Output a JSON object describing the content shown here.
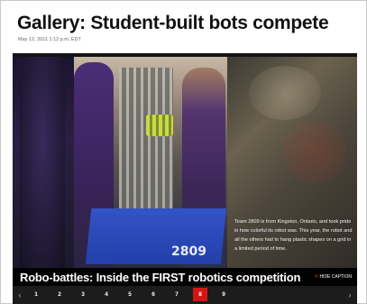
{
  "article": {
    "title": "Gallery: Student-built bots compete",
    "dateline": "May 12, 2011 1:12 p.m. EDT"
  },
  "slide": {
    "robot_number": "2809",
    "caption": "Team 2809 is from Kingston, Ontario, and took pride in how colorful its robot was. This year, the robot and all the others had to hang plastic shapes on a grid in a limited period of time.",
    "title": "Robo-battles: Inside the FIRST robotics competition",
    "hide_caption_label": "HIDE CAPTION",
    "hide_caption_icon": "x-icon"
  },
  "pager": {
    "prev_icon": "chevron-left-icon",
    "next_icon": "chevron-right-icon",
    "pages": [
      "1",
      "2",
      "3",
      "4",
      "5",
      "6",
      "7",
      "8",
      "9"
    ],
    "active_index": 7,
    "active_color": "#d41515"
  }
}
